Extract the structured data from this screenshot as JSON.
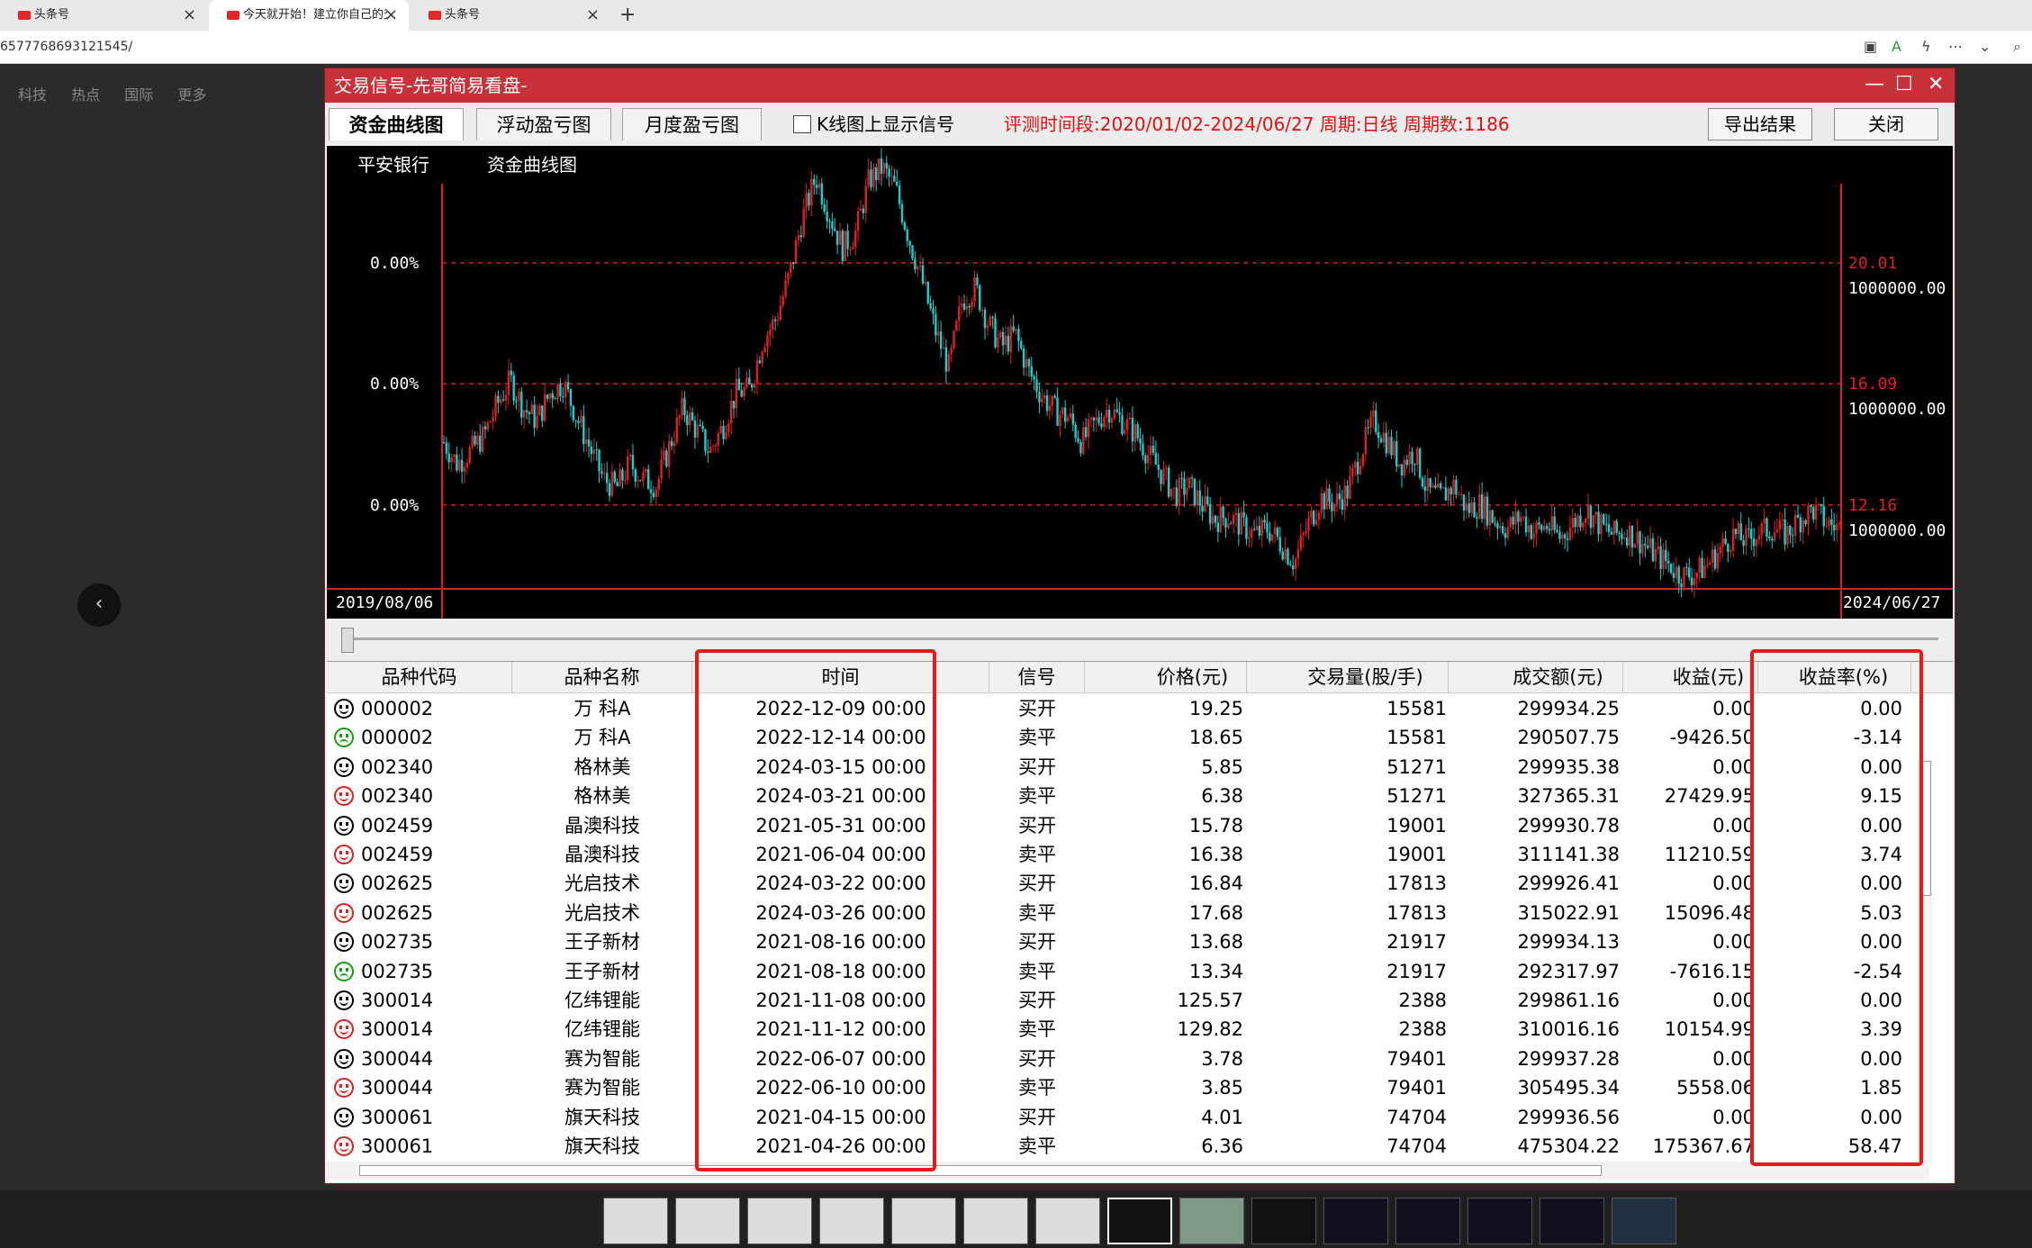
{
  "browser": {
    "tabs": [
      {
        "label": "头条号",
        "active": false
      },
      {
        "label": "今天就开始！建立你自己的交易系统",
        "active": true
      },
      {
        "label": "头条号",
        "active": false
      }
    ],
    "url": "6577768693121545/"
  },
  "page": {
    "nav": [
      "科技",
      "热点",
      "国际",
      "更多"
    ]
  },
  "window": {
    "title": "交易信号-先哥简易看盘-",
    "tabs": [
      "资金曲线图",
      "浮动盈亏图",
      "月度盈亏图"
    ],
    "checkbox_label": "K线图上显示信号",
    "period_text": "评测时间段:2020/01/02-2024/06/27  周期:日线  周期数:1186",
    "export_label": "导出结果",
    "close_label": "关闭"
  },
  "chart_data": {
    "type": "line",
    "title": "资金曲线图",
    "stock_name": "平安银行",
    "left_labels": [
      "0.00%",
      "0.00%",
      "0.00%"
    ],
    "right_prices": [
      "20.01",
      "16.09",
      "12.16"
    ],
    "right_funds": [
      "1000000.00",
      "1000000.00",
      "1000000.00"
    ],
    "x_start": "2019/08/06",
    "x_end": "2024/06/27",
    "ylim": [
      9.5,
      23.8
    ],
    "series": [
      {
        "values": [
          14.2,
          13.5,
          13.9,
          14.4,
          15.4,
          16.2,
          15.3,
          14.9,
          15.8,
          16.1,
          15.0,
          14.0,
          13.0,
          12.7,
          13.5,
          13.0,
          12.8,
          14.1,
          15.3,
          14.6,
          13.9,
          14.7,
          15.8,
          15.9,
          17.5,
          18.2,
          19.6,
          21.5,
          22.8,
          21.6,
          20.5,
          21.0,
          22.7,
          23.1,
          22.4,
          20.8,
          19.4,
          17.8,
          16.6,
          18.8,
          19.2,
          18.0,
          17.3,
          17.7,
          16.5,
          15.7,
          15.2,
          15.0,
          14.2,
          14.8,
          15.3,
          14.9,
          14.5,
          13.8,
          13.2,
          12.5,
          12.8,
          12.2,
          11.7,
          11.8,
          11.5,
          11.2,
          11.4,
          10.9,
          10.3,
          11.5,
          12.4,
          12.2,
          12.6,
          13.9,
          14.9,
          14.2,
          13.5,
          13.9,
          12.6,
          12.4,
          12.8,
          12.0,
          12.2,
          11.7,
          11.4,
          11.8,
          11.3,
          11.5,
          11.1,
          11.6,
          12.0,
          11.5,
          11.2,
          11.3,
          11.0,
          10.6,
          10.3,
          9.9,
          9.9,
          10.2,
          10.7,
          11.2,
          11.0,
          11.3,
          11.4,
          11.2,
          11.7,
          12.0,
          11.6,
          11.4
        ]
      }
    ],
    "grid": true,
    "legend": "none"
  },
  "table": {
    "headers": [
      "品种代码",
      "品种名称",
      "时间",
      "信号",
      "价格(元)",
      "交易量(股/手)",
      "成交额(元)",
      "收益(元)",
      "收益率(%)"
    ],
    "rows": [
      {
        "mood": "neutral",
        "code": "000002",
        "name": "万 科A",
        "time": "2022-12-09 00:00",
        "signal": "买开",
        "price": "19.25",
        "vol": "15581",
        "amount": "299934.25",
        "profit": "0.00",
        "rate": "0.00"
      },
      {
        "mood": "down",
        "code": "000002",
        "name": "万 科A",
        "time": "2022-12-14 00:00",
        "signal": "卖平",
        "price": "18.65",
        "vol": "15581",
        "amount": "290507.75",
        "profit": "-9426.50",
        "rate": "-3.14"
      },
      {
        "mood": "neutral",
        "code": "002340",
        "name": "格林美",
        "time": "2024-03-15 00:00",
        "signal": "买开",
        "price": "5.85",
        "vol": "51271",
        "amount": "299935.38",
        "profit": "0.00",
        "rate": "0.00"
      },
      {
        "mood": "up",
        "code": "002340",
        "name": "格林美",
        "time": "2024-03-21 00:00",
        "signal": "卖平",
        "price": "6.38",
        "vol": "51271",
        "amount": "327365.31",
        "profit": "27429.95",
        "rate": "9.15"
      },
      {
        "mood": "neutral",
        "code": "002459",
        "name": "晶澳科技",
        "time": "2021-05-31 00:00",
        "signal": "买开",
        "price": "15.78",
        "vol": "19001",
        "amount": "299930.78",
        "profit": "0.00",
        "rate": "0.00"
      },
      {
        "mood": "up",
        "code": "002459",
        "name": "晶澳科技",
        "time": "2021-06-04 00:00",
        "signal": "卖平",
        "price": "16.38",
        "vol": "19001",
        "amount": "311141.38",
        "profit": "11210.59",
        "rate": "3.74"
      },
      {
        "mood": "neutral",
        "code": "002625",
        "name": "光启技术",
        "time": "2024-03-22 00:00",
        "signal": "买开",
        "price": "16.84",
        "vol": "17813",
        "amount": "299926.41",
        "profit": "0.00",
        "rate": "0.00"
      },
      {
        "mood": "up",
        "code": "002625",
        "name": "光启技术",
        "time": "2024-03-26 00:00",
        "signal": "卖平",
        "price": "17.68",
        "vol": "17813",
        "amount": "315022.91",
        "profit": "15096.48",
        "rate": "5.03"
      },
      {
        "mood": "neutral",
        "code": "002735",
        "name": "王子新材",
        "time": "2021-08-16 00:00",
        "signal": "买开",
        "price": "13.68",
        "vol": "21917",
        "amount": "299934.13",
        "profit": "0.00",
        "rate": "0.00"
      },
      {
        "mood": "down",
        "code": "002735",
        "name": "王子新材",
        "time": "2021-08-18 00:00",
        "signal": "卖平",
        "price": "13.34",
        "vol": "21917",
        "amount": "292317.97",
        "profit": "-7616.15",
        "rate": "-2.54"
      },
      {
        "mood": "neutral",
        "code": "300014",
        "name": "亿纬锂能",
        "time": "2021-11-08 00:00",
        "signal": "买开",
        "price": "125.57",
        "vol": "2388",
        "amount": "299861.16",
        "profit": "0.00",
        "rate": "0.00"
      },
      {
        "mood": "up",
        "code": "300014",
        "name": "亿纬锂能",
        "time": "2021-11-12 00:00",
        "signal": "卖平",
        "price": "129.82",
        "vol": "2388",
        "amount": "310016.16",
        "profit": "10154.99",
        "rate": "3.39"
      },
      {
        "mood": "neutral",
        "code": "300044",
        "name": "赛为智能",
        "time": "2022-06-07 00:00",
        "signal": "买开",
        "price": "3.78",
        "vol": "79401",
        "amount": "299937.28",
        "profit": "0.00",
        "rate": "0.00"
      },
      {
        "mood": "up",
        "code": "300044",
        "name": "赛为智能",
        "time": "2022-06-10 00:00",
        "signal": "卖平",
        "price": "3.85",
        "vol": "79401",
        "amount": "305495.34",
        "profit": "5558.06",
        "rate": "1.85"
      },
      {
        "mood": "neutral",
        "code": "300061",
        "name": "旗天科技",
        "time": "2021-04-15 00:00",
        "signal": "买开",
        "price": "4.01",
        "vol": "74704",
        "amount": "299936.56",
        "profit": "0.00",
        "rate": "0.00"
      },
      {
        "mood": "up",
        "code": "300061",
        "name": "旗天科技",
        "time": "2021-04-26 00:00",
        "signal": "卖平",
        "price": "6.36",
        "vol": "74704",
        "amount": "475304.22",
        "profit": "175367.67",
        "rate": "58.47"
      }
    ]
  },
  "colors": {
    "titlebar": "#c8313a",
    "highlight_box": "#e8191b",
    "candle_up": "#e02020",
    "candle_down": "#19d0d0",
    "chart_bg": "#000000"
  }
}
